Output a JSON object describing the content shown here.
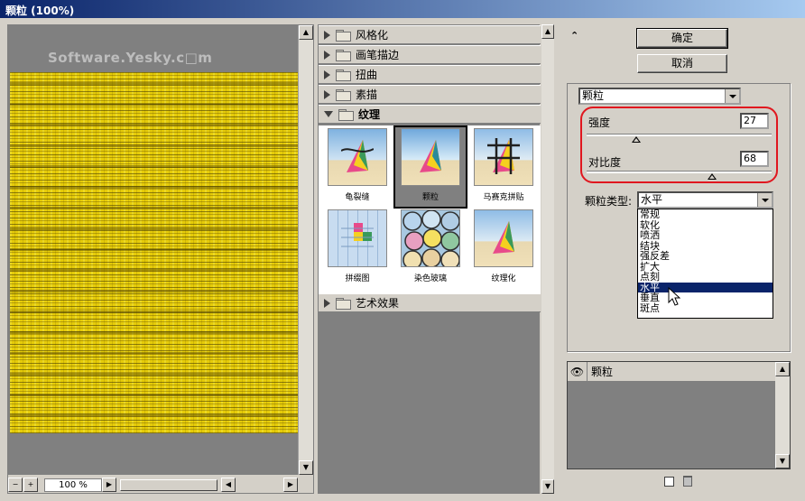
{
  "window": {
    "title": "颗粒 (100%)"
  },
  "preview": {
    "watermark": "Software.Yesky.c□m",
    "zoom": "100 %",
    "zoom_out": "−",
    "zoom_in": "+"
  },
  "categories": {
    "collapsed_top": [
      "风格化",
      "画笔描边",
      "扭曲",
      "素描"
    ],
    "expanded": "纹理",
    "collapsed_bottom": [
      "艺术效果"
    ],
    "thumbnails": [
      {
        "label": "龟裂缝"
      },
      {
        "label": "颗粒"
      },
      {
        "label": "马赛克拼贴"
      },
      {
        "label": "拼缀图"
      },
      {
        "label": "染色玻璃"
      },
      {
        "label": "纹理化"
      }
    ],
    "selected_thumbnail": "颗粒"
  },
  "buttons": {
    "ok": "确定",
    "cancel": "取消",
    "collapse": "⌃"
  },
  "filter_select": {
    "value": "颗粒"
  },
  "params": {
    "intensity": {
      "label": "强度",
      "value": "27",
      "fraction": 0.27
    },
    "contrast": {
      "label": "对比度",
      "value": "68",
      "fraction": 0.68
    },
    "grain_type": {
      "label": "颗粒类型:",
      "value": "水平",
      "options": [
        "常规",
        "软化",
        "喷洒",
        "结块",
        "强反差",
        "扩大",
        "点刻",
        "水平",
        "垂直",
        "斑点"
      ],
      "highlighted": "水平"
    }
  },
  "layers": {
    "items": [
      {
        "name": "颗粒"
      }
    ]
  },
  "colors": {
    "highlight_oval": "#e0171f",
    "grain_yellow": "#e6cc0a",
    "selection": "#0a246a"
  }
}
